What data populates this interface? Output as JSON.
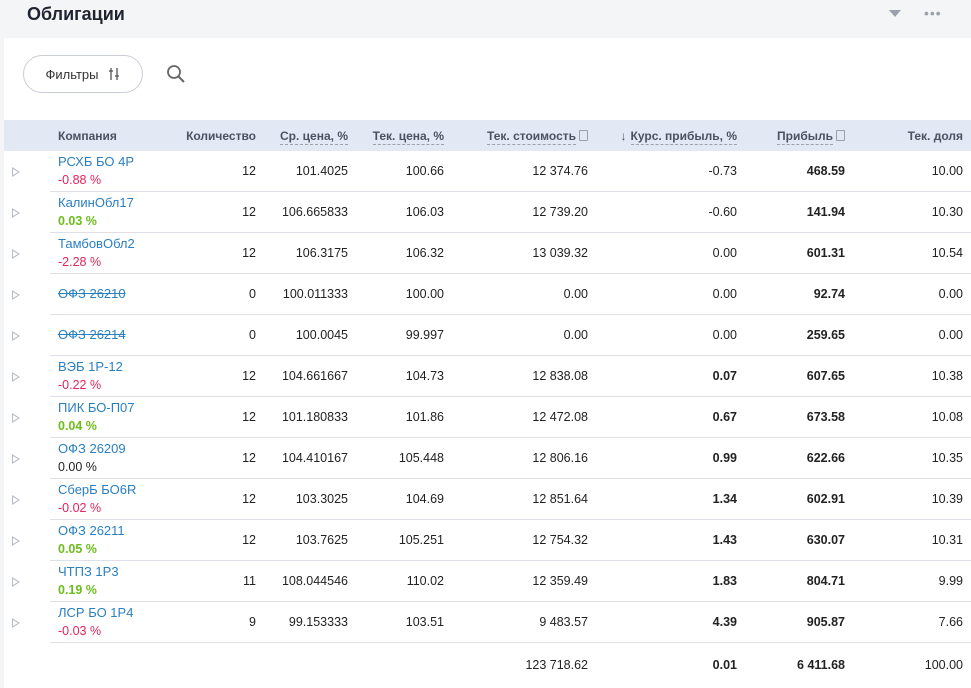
{
  "header": {
    "title": "Облигации"
  },
  "toolbar": {
    "filter_label": "Фильтры"
  },
  "columns": {
    "company": "Компания",
    "quantity": "Количество",
    "avg_price": "Ср. цена, %",
    "cur_price": "Тек. цена, %",
    "cur_value": "Тек. стоимость",
    "fx_profit": "Курс. прибыль, %",
    "profit": "Прибыль",
    "share": "Тек. доля"
  },
  "rows": [
    {
      "name": "РСХБ БО 4Р",
      "change": "-0.88 %",
      "change_sign": "neg",
      "struck": false,
      "qty": "12",
      "avg": "101.4025",
      "cur": "100.66",
      "value": "12 374.76",
      "fx": "-0.73",
      "fx_sign": "neg",
      "profit": "468.59",
      "share": "10.00"
    },
    {
      "name": "КалинОбл17",
      "change": "0.03 %",
      "change_sign": "pos",
      "struck": false,
      "qty": "12",
      "avg": "106.665833",
      "cur": "106.03",
      "value": "12 739.20",
      "fx": "-0.60",
      "fx_sign": "neg",
      "profit": "141.94",
      "share": "10.30"
    },
    {
      "name": "ТамбовОбл2",
      "change": "-2.28 %",
      "change_sign": "neg",
      "struck": false,
      "qty": "12",
      "avg": "106.3175",
      "cur": "106.32",
      "value": "13 039.32",
      "fx": "0.00",
      "fx_sign": "zero",
      "profit": "601.31",
      "share": "10.54"
    },
    {
      "name": "ОФЗ 26210",
      "change": "",
      "change_sign": "zero",
      "struck": true,
      "qty": "0",
      "avg": "100.011333",
      "cur": "100.00",
      "value": "0.00",
      "fx": "0.00",
      "fx_sign": "zero",
      "profit": "92.74",
      "share": "0.00"
    },
    {
      "name": "ОФЗ 26214",
      "change": "",
      "change_sign": "zero",
      "struck": true,
      "qty": "0",
      "avg": "100.0045",
      "cur": "99.997",
      "value": "0.00",
      "fx": "0.00",
      "fx_sign": "zero",
      "profit": "259.65",
      "share": "0.00"
    },
    {
      "name": "ВЭБ 1Р-12",
      "change": "-0.22 %",
      "change_sign": "neg",
      "struck": false,
      "qty": "12",
      "avg": "104.661667",
      "cur": "104.73",
      "value": "12 838.08",
      "fx": "0.07",
      "fx_sign": "pos",
      "profit": "607.65",
      "share": "10.38"
    },
    {
      "name": "ПИК БО-П07",
      "change": "0.04 %",
      "change_sign": "pos",
      "struck": false,
      "qty": "12",
      "avg": "101.180833",
      "cur": "101.86",
      "value": "12 472.08",
      "fx": "0.67",
      "fx_sign": "pos",
      "profit": "673.58",
      "share": "10.08"
    },
    {
      "name": "ОФЗ 26209",
      "change": "0.00 %",
      "change_sign": "zero",
      "struck": false,
      "qty": "12",
      "avg": "104.410167",
      "cur": "105.448",
      "value": "12 806.16",
      "fx": "0.99",
      "fx_sign": "pos",
      "profit": "622.66",
      "share": "10.35"
    },
    {
      "name": "СберБ БО6R",
      "change": "-0.02 %",
      "change_sign": "neg",
      "struck": false,
      "qty": "12",
      "avg": "103.3025",
      "cur": "104.69",
      "value": "12 851.64",
      "fx": "1.34",
      "fx_sign": "pos",
      "profit": "602.91",
      "share": "10.39"
    },
    {
      "name": "ОФЗ 26211",
      "change": "0.05 %",
      "change_sign": "pos",
      "struck": false,
      "qty": "12",
      "avg": "103.7625",
      "cur": "105.251",
      "value": "12 754.32",
      "fx": "1.43",
      "fx_sign": "pos",
      "profit": "630.07",
      "share": "10.31"
    },
    {
      "name": "ЧТПЗ 1Р3",
      "change": "0.19 %",
      "change_sign": "pos",
      "struck": false,
      "qty": "11",
      "avg": "108.044546",
      "cur": "110.02",
      "value": "12 359.49",
      "fx": "1.83",
      "fx_sign": "pos",
      "profit": "804.71",
      "share": "9.99"
    },
    {
      "name": "ЛСР БО 1Р4",
      "change": "-0.03 %",
      "change_sign": "neg",
      "struck": false,
      "qty": "9",
      "avg": "99.153333",
      "cur": "103.51",
      "value": "9 483.57",
      "fx": "4.39",
      "fx_sign": "pos",
      "profit": "905.87",
      "share": "7.66"
    }
  ],
  "totals": {
    "value": "123 718.62",
    "fx": "0.01",
    "profit": "6 411.68",
    "share": "100.00"
  },
  "colors": {
    "negative": "#e5245a",
    "positive": "#6cbd1b",
    "link": "#2a7fc1",
    "header_bg": "#e3e9f4"
  },
  "icons": {
    "filter": "sliders-icon",
    "search": "search-icon",
    "expand": "triangle-right-icon",
    "menu": "more-dots-icon",
    "collapse": "caret-down-icon"
  }
}
